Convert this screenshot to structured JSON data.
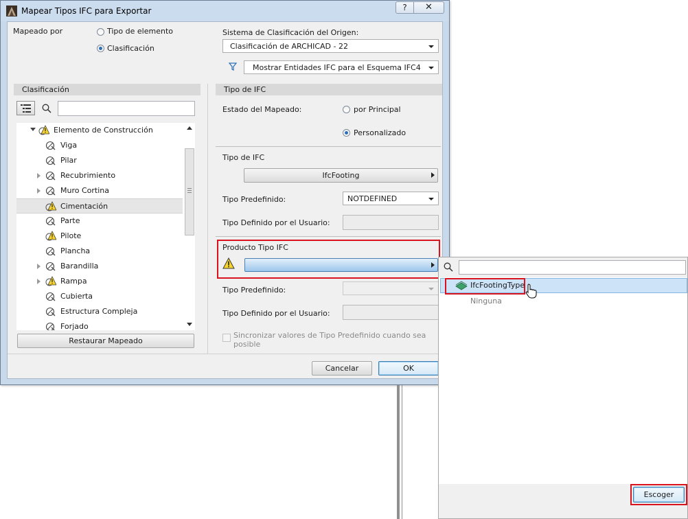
{
  "dialog": {
    "title": "Mapear Tipos IFC para Exportar",
    "help_label": "?",
    "close_label": "✕"
  },
  "mapping_by": {
    "label": "Mapeado por",
    "option_element_type": "Tipo de elemento",
    "option_classification": "Clasificación",
    "selected": "Clasificación"
  },
  "source_system": {
    "label": "Sistema de Clasificación del Origen:",
    "value": "Clasificación de ARCHICAD - 22"
  },
  "filter": {
    "value": "Mostrar Entidades IFC para el Esquema IFC4"
  },
  "left_panel": {
    "header": "Clasificación",
    "search_value": "",
    "tree": [
      {
        "label": "Elemento de Construcción",
        "expander": "open",
        "icon": "warning-icon",
        "level": 0
      },
      {
        "label": "Viga",
        "expander": "none",
        "icon": "element-icon",
        "level": 1
      },
      {
        "label": "Pilar",
        "expander": "none",
        "icon": "element-icon",
        "level": 1
      },
      {
        "label": "Recubrimiento",
        "expander": "closed",
        "icon": "element-icon",
        "level": 1
      },
      {
        "label": "Muro Cortina",
        "expander": "closed",
        "icon": "element-icon",
        "level": 1
      },
      {
        "label": "Cimentación",
        "expander": "none",
        "icon": "warning-icon",
        "level": 1,
        "selected": true
      },
      {
        "label": "Parte",
        "expander": "none",
        "icon": "element-icon",
        "level": 1
      },
      {
        "label": "Pilote",
        "expander": "none",
        "icon": "warning-icon",
        "level": 1
      },
      {
        "label": "Plancha",
        "expander": "none",
        "icon": "element-icon",
        "level": 1
      },
      {
        "label": "Barandilla",
        "expander": "closed",
        "icon": "element-icon",
        "level": 1
      },
      {
        "label": "Rampa",
        "expander": "closed",
        "icon": "warning-icon",
        "level": 1
      },
      {
        "label": "Cubierta",
        "expander": "none",
        "icon": "element-icon",
        "level": 1
      },
      {
        "label": "Estructura Compleja",
        "expander": "none",
        "icon": "element-icon",
        "level": 1
      },
      {
        "label": "Forjado",
        "expander": "none",
        "icon": "element-icon",
        "level": 1
      }
    ],
    "restore_button": "Restaurar Mapeado"
  },
  "right_panel": {
    "header": "Tipo de IFC",
    "mapping_state_label": "Estado del Mapeado:",
    "option_by_parent": "por Principal",
    "option_custom": "Personalizado",
    "mapping_state_selected": "Personalizado",
    "ifc_type_label": "Tipo de IFC",
    "ifc_type_value": "IfcFooting",
    "predefined_label": "Tipo Predefinido:",
    "predefined_value": "NOTDEFINED",
    "user_defined_label": "Tipo Definido por el Usuario:",
    "user_defined_value": "",
    "product_type_label": "Producto Tipo IFC",
    "product_type_value": "",
    "predefined2_label": "Tipo Predefinido:",
    "predefined2_value": "",
    "user_defined2_label": "Tipo Definido por el Usuario:",
    "user_defined2_value": "",
    "sync_checkbox_label_line1": "Sincronizar valores de Tipo Predefinido cuando sea",
    "sync_checkbox_label_line2": "posible",
    "sync_checked": false
  },
  "footer": {
    "cancel_label": "Cancelar",
    "ok_label": "OK"
  },
  "popup": {
    "search_value": "",
    "items": [
      {
        "label": "IfcFootingType",
        "selected": true,
        "icon": "ifc-type-icon"
      },
      {
        "label": "Ninguna",
        "selected": false
      }
    ],
    "choose_label": "Escoger"
  },
  "colors": {
    "accent_blue": "#2a6fba",
    "highlight_red": "#d9131d",
    "selection_blue": "#cde3f7",
    "ok_border": "#3c7fb1"
  }
}
